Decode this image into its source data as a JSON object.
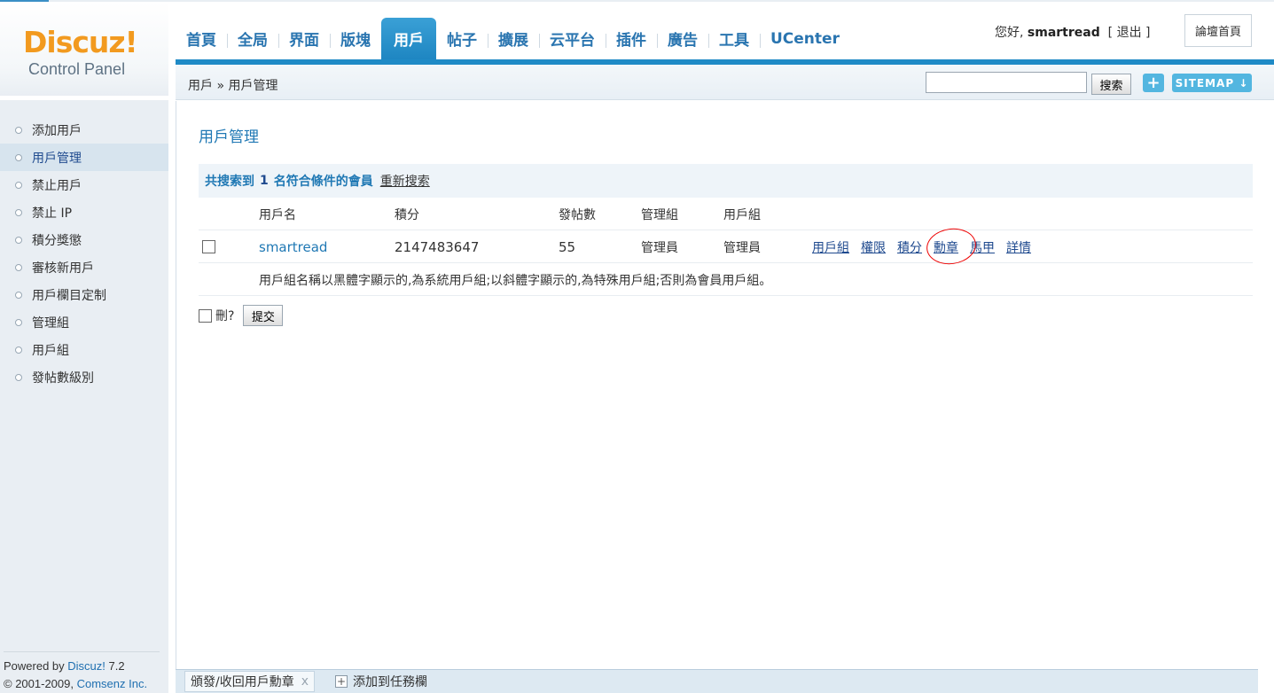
{
  "logo": {
    "main": "Discuz!",
    "sub": "Control Panel"
  },
  "nav": {
    "items": [
      {
        "label": "首頁"
      },
      {
        "label": "全局"
      },
      {
        "label": "界面"
      },
      {
        "label": "版塊"
      },
      {
        "label": "用戶",
        "active": true
      },
      {
        "label": "帖子"
      },
      {
        "label": "擴展"
      },
      {
        "label": "云平台"
      },
      {
        "label": "插件"
      },
      {
        "label": "廣告"
      },
      {
        "label": "工具"
      },
      {
        "label": "UCenter"
      }
    ]
  },
  "header": {
    "greeting": "您好,",
    "username": "smartread",
    "logout": "[ 退出 ]",
    "forum_home": "論壇首頁"
  },
  "subhead": {
    "breadcrumb": "用戶 » 用戶管理",
    "search_button": "搜索",
    "plus": "+",
    "sitemap": "SITEMAP ↓"
  },
  "sidebar": {
    "items": [
      {
        "label": "添加用戶"
      },
      {
        "label": "用戶管理",
        "active": true
      },
      {
        "label": "禁止用戶"
      },
      {
        "label": "禁止 IP"
      },
      {
        "label": "積分獎懲"
      },
      {
        "label": "審核新用戶"
      },
      {
        "label": "用戶欄目定制"
      },
      {
        "label": "管理組"
      },
      {
        "label": "用戶組"
      },
      {
        "label": "發帖數級別"
      }
    ],
    "footer": {
      "powered": "Powered by",
      "product": "Discuz!",
      "version": "7.2",
      "copyright": "© 2001-2009,",
      "company": "Comsenz Inc."
    }
  },
  "main": {
    "title": "用戶管理",
    "result": {
      "prefix": "共搜索到",
      "count": "1",
      "suffix": "名符合條件的會員",
      "research": "重新搜索"
    },
    "columns": [
      "用戶名",
      "積分",
      "發帖數",
      "管理組",
      "用戶組"
    ],
    "rows": [
      {
        "username": "smartread",
        "credits": "2147483647",
        "posts": "55",
        "admin_group": "管理員",
        "user_group": "管理員",
        "actions": [
          "用戶組",
          "權限",
          "積分",
          "勳章",
          "馬甲",
          "詳情"
        ]
      }
    ],
    "note": "用戶組名稱以黑體字顯示的,為系統用戶組;以斜體字顯示的,為特殊用戶組;否則為會員用戶組。",
    "delete_label": "刪?",
    "submit_label": "提交"
  },
  "taskbar": {
    "tab_label": "頒發/收回用戶勳章",
    "tab_close": "x",
    "add_label": "添加到任務欄"
  },
  "colors": {
    "accent": "#1f8ac6",
    "nav_text": "#2a75b0",
    "logo": "#f29a1f",
    "annotation": "#e00000"
  }
}
